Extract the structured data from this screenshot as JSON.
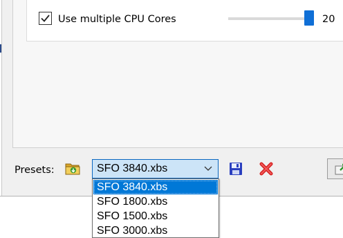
{
  "options": {
    "cpu_checkbox_label": "Use multiple CPU Cores",
    "cpu_checked": true,
    "cpu_slider_value": "20"
  },
  "presets": {
    "label": "Presets:",
    "selected": "SFO 3840.xbs",
    "options": [
      "SFO 3840.xbs",
      "SFO 1800.xbs",
      "SFO 1500.xbs",
      "SFO 3000.xbs"
    ]
  },
  "icons": {
    "open": "folder-open-icon",
    "save": "save-icon",
    "delete": "delete-icon",
    "chevron": "chevron-down-icon",
    "apply": "apply-arrow-icon"
  },
  "colors": {
    "accent": "#0078d7",
    "combo_bg": "#cce4f7",
    "delete_red": "#d42020",
    "save_blue": "#2a3fbf"
  }
}
